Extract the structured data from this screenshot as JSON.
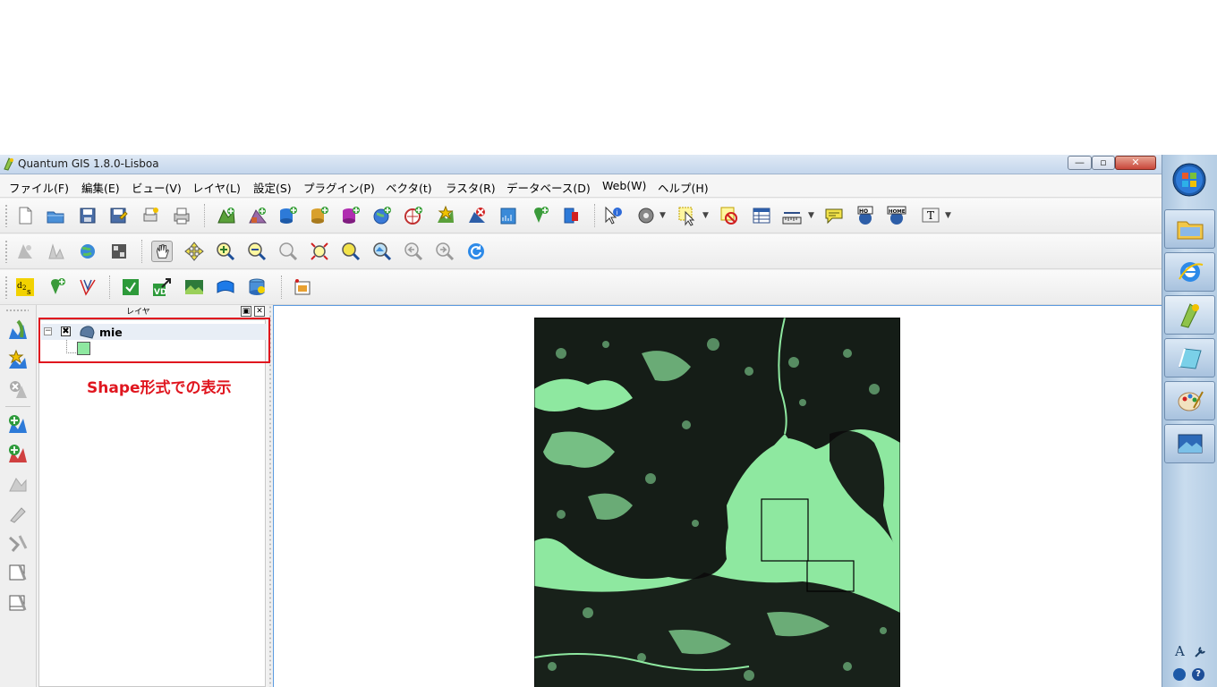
{
  "window": {
    "title": "Quantum GIS 1.8.0-Lisboa",
    "minimize": "—",
    "maximize": "▫",
    "close": "✕"
  },
  "menu": [
    "ファイル(F)",
    "編集(E)",
    "ビュー(V)",
    "レイヤ(L)",
    "設定(S)",
    "プラグイン(P)",
    "ベクタ(t)",
    "ラスタ(R)",
    "データベース(D)",
    "Web(W)",
    "ヘルプ(H)"
  ],
  "layer_panel": {
    "title": "レイヤ",
    "float_button": "▣",
    "close_button": "✕",
    "layers": [
      {
        "name": "mie",
        "visible": true,
        "expanded": true,
        "expander": "−",
        "checkmark": "✖",
        "legend_color": "#8ee8a0"
      }
    ]
  },
  "annotation": {
    "text": "Shape形式での表示",
    "color": "#e0161f"
  },
  "map": {
    "fill_color": "#8ee8a0",
    "outline_color": "#000000"
  },
  "taskbar": {
    "tray_glyph": "A",
    "icons": [
      "windows-orb-icon",
      "folder-icon",
      "internet-explorer-icon",
      "qgis-icon",
      "notebook-icon",
      "paint-icon",
      "picture-viewer-icon"
    ]
  }
}
